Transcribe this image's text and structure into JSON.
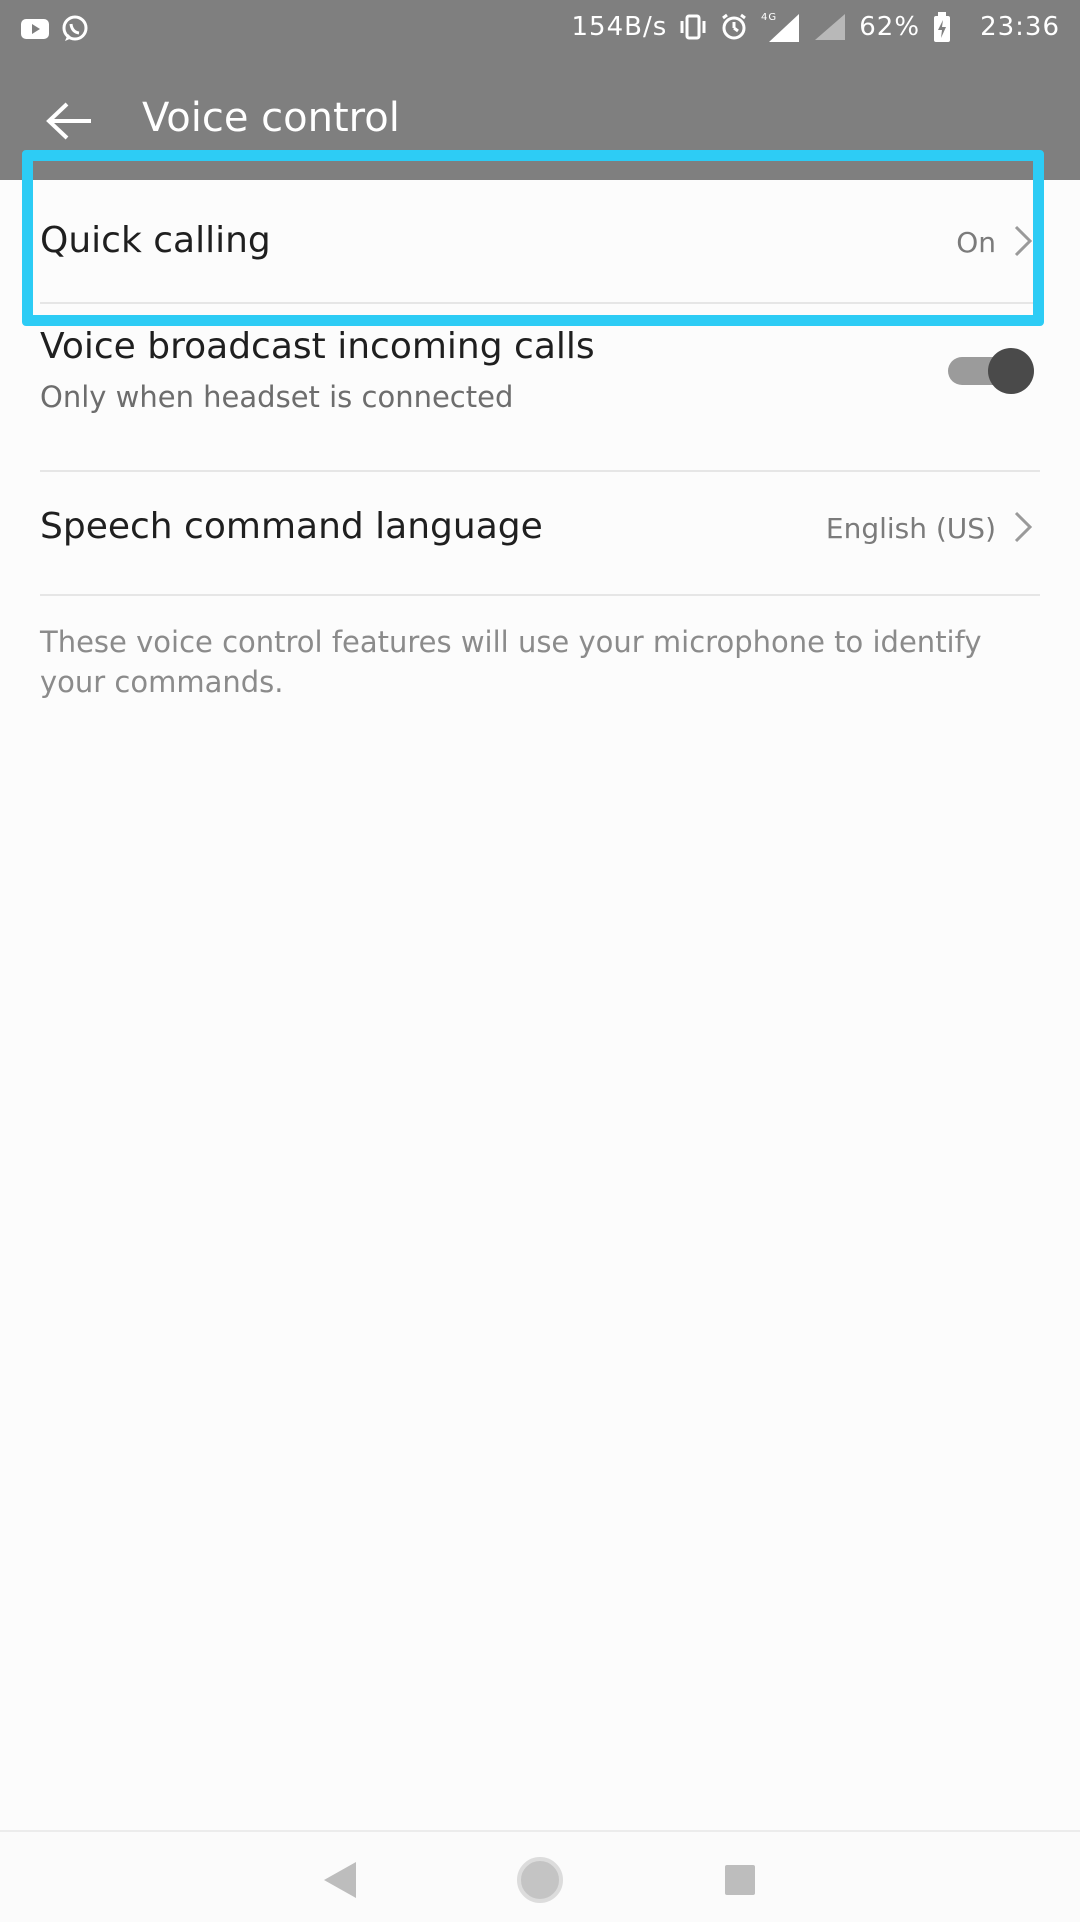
{
  "status_bar": {
    "left_icons": [
      "youtube-icon",
      "whatsapp-icon"
    ],
    "network_speed": "154B/s",
    "network_type": "4G",
    "battery": "62%",
    "time": "23:36"
  },
  "header": {
    "title": "Voice control",
    "back_icon": "back-arrow-icon"
  },
  "settings": {
    "quick_calling": {
      "label": "Quick calling",
      "value": "On"
    },
    "voice_broadcast": {
      "label": "Voice broadcast incoming calls",
      "subtitle": "Only when headset is connected",
      "toggle_on": true
    },
    "speech_language": {
      "label": "Speech command language",
      "value": "English (US)"
    }
  },
  "footnote": "These voice control features will use your microphone to identify your commands.",
  "nav_bar": {
    "icons": [
      "back-triangle-icon",
      "home-circle-icon",
      "recents-square-icon"
    ]
  },
  "colors": {
    "highlight": "#2dccf5",
    "header_bg": "#7f7f7f",
    "page_bg": "#fcfcfc"
  }
}
